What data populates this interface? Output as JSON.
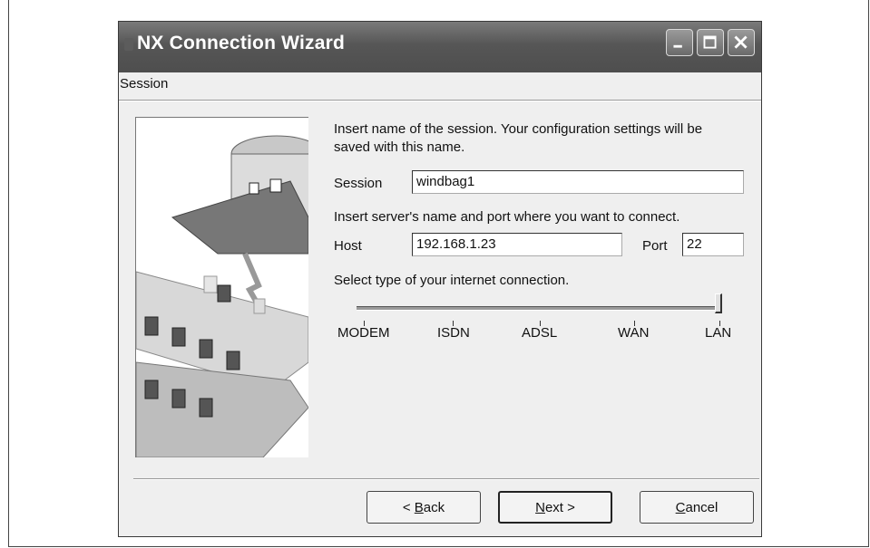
{
  "window": {
    "title": "NX Connection Wizard",
    "controls": {
      "minimize": "minimize-icon",
      "maximize": "maximize-icon",
      "close": "close-icon"
    }
  },
  "page": {
    "section": "Session"
  },
  "form": {
    "session_instruction_line1": "Insert name of the session. Your configuration settings will be",
    "session_instruction_line2": "saved with this name.",
    "session_label": "Session",
    "session_value": "windbag1",
    "server_instruction": "Insert server's name and port where you want to connect.",
    "host_label": "Host",
    "host_value": "192.168.1.23",
    "port_label": "Port",
    "port_value": "22",
    "connection_instruction": "Select type of your internet connection.",
    "connection_options": [
      "MODEM",
      "ISDN",
      "ADSL",
      "WAN",
      "LAN"
    ],
    "connection_selected": "LAN"
  },
  "buttons": {
    "back_prefix": "< ",
    "back_key": "B",
    "back_rest": "ack",
    "next_key": "N",
    "next_rest": "ext >",
    "cancel_key": "C",
    "cancel_rest": "ancel"
  }
}
